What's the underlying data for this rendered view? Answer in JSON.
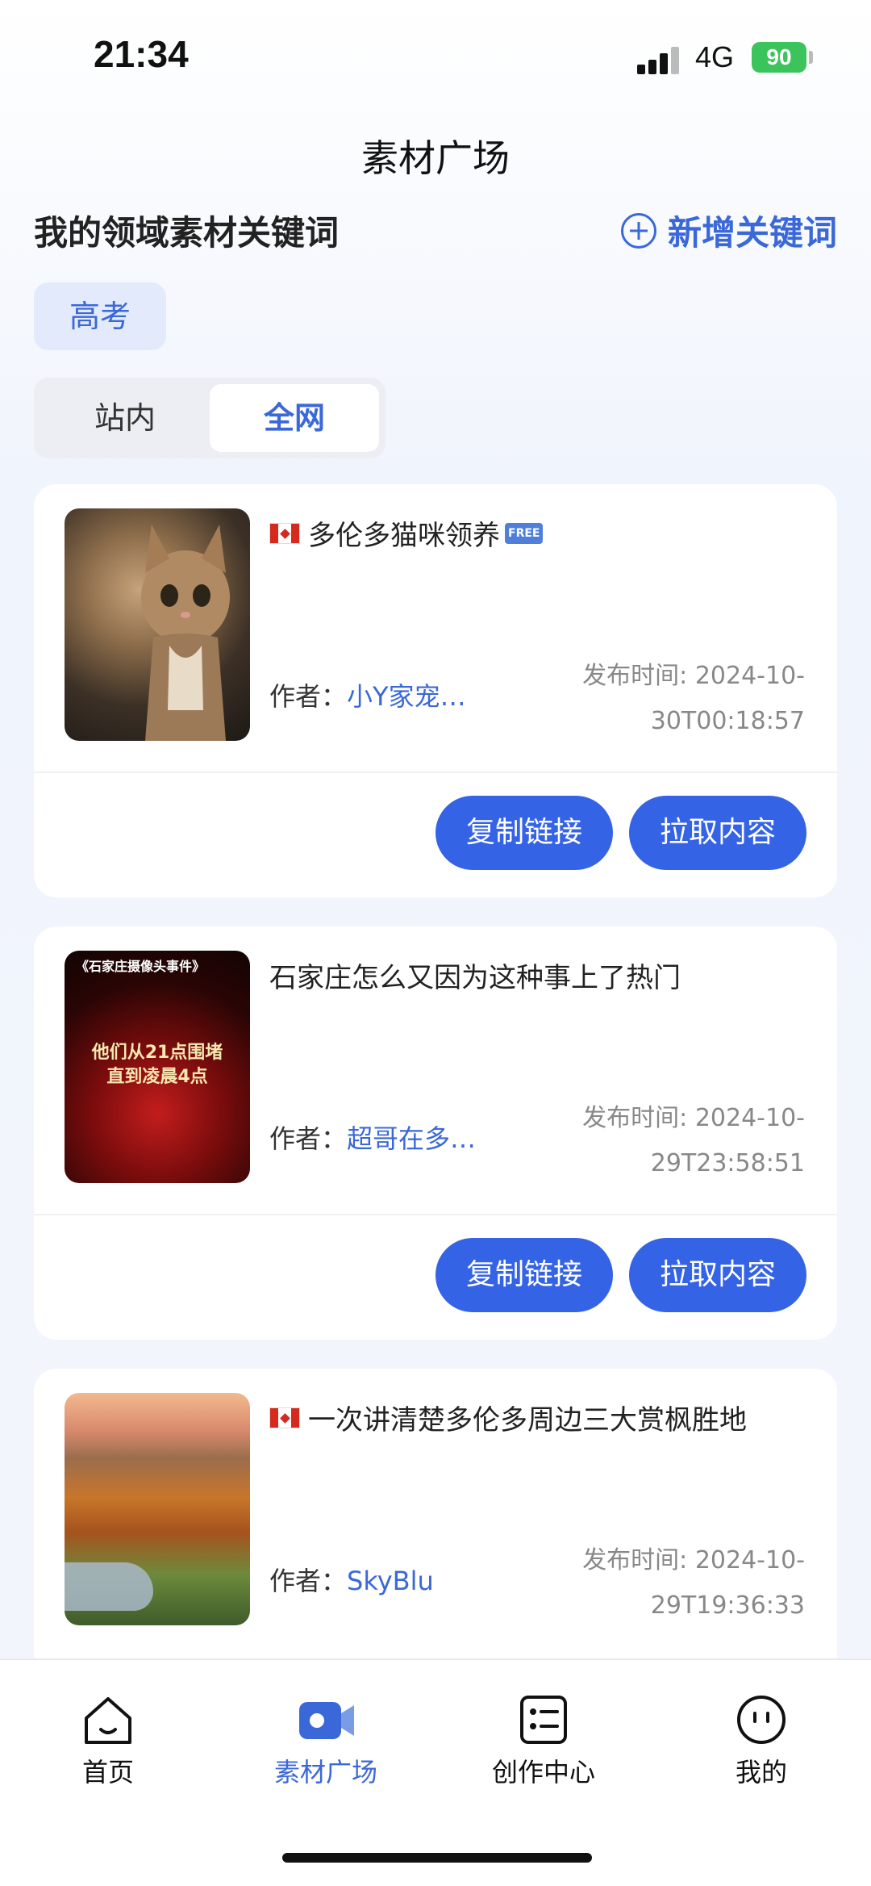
{
  "status_bar": {
    "time": "21:34",
    "network": "4G",
    "battery": "90"
  },
  "header": {
    "title": "素材广场"
  },
  "keywords_section": {
    "title": "我的领域素材关键词",
    "add_label": "新增关键词",
    "chips": [
      "高考"
    ]
  },
  "scope_toggle": {
    "options": [
      "站内",
      "全网"
    ],
    "selected": "全网"
  },
  "cards": [
    {
      "title": "多伦多猫咪领养",
      "flag": "canada-flag-icon",
      "badge": "FREE",
      "author_label": "作者：",
      "author": "小Y家宠…",
      "time_label": "发布时间: 2024-10-",
      "time_value": "30T00:18:57",
      "copy_label": "复制链接",
      "pull_label": "拉取内容"
    },
    {
      "title": "石家庄怎么又因为这种事上了热门",
      "thumb_top_text": "《石家庄摄像头事件》",
      "thumb_text_1": "他们从21点围堵",
      "thumb_text_2": "直到凌晨4点",
      "author_label": "作者：",
      "author": "超哥在多…",
      "time_label": "发布时间: 2024-10-",
      "time_value": "29T23:58:51",
      "copy_label": "复制链接",
      "pull_label": "拉取内容"
    },
    {
      "title": "一次讲清楚多伦多周边三大赏枫胜地",
      "flag": "canada-flag-icon",
      "author_label": "作者：",
      "author": "SkyBlu",
      "time_label": "发布时间: 2024-10-",
      "time_value": "29T19:36:33"
    }
  ],
  "tab_bar": {
    "items": [
      {
        "label": "首页",
        "icon": "home-icon"
      },
      {
        "label": "素材广场",
        "icon": "camera-icon"
      },
      {
        "label": "创作中心",
        "icon": "checklist-icon"
      },
      {
        "label": "我的",
        "icon": "profile-face-icon"
      }
    ],
    "active": "素材广场"
  },
  "colors": {
    "accent": "#3b68d8",
    "button": "#3463e6",
    "battery": "#3cc45c"
  }
}
